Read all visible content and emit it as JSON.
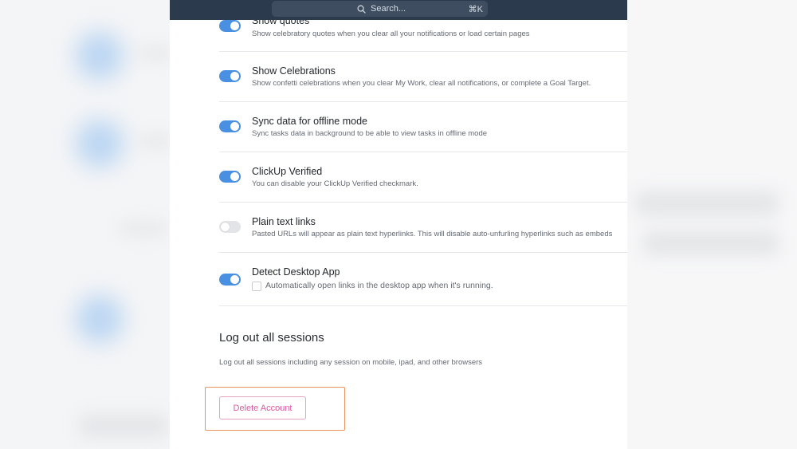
{
  "search": {
    "label": "Search...",
    "shortcut": "⌘K",
    "icon": "search-icon"
  },
  "settings": [
    {
      "title": "Show quotes",
      "description": "Show celebratory quotes when you clear all your notifications or load certain pages",
      "enabled": true
    },
    {
      "title": "Show Celebrations",
      "description": "Show confetti celebrations when you clear My Work, clear all notifications, or complete a Goal Target.",
      "enabled": true
    },
    {
      "title": "Sync data for offline mode",
      "description": "Sync tasks data in background to be able to view tasks in offline mode",
      "enabled": true
    },
    {
      "title": "ClickUp Verified",
      "description": "You can disable your ClickUp Verified checkmark.",
      "enabled": true
    },
    {
      "title": "Plain text links",
      "description": "Pasted URLs will appear as plain text hyperlinks. This will disable auto-unfurling hyperlinks such as embeds",
      "enabled": false
    },
    {
      "title": "Detect Desktop App",
      "checkbox_label": "Automatically open links in the desktop app when it's running.",
      "enabled": true,
      "checkbox_checked": false
    }
  ],
  "logout": {
    "title": "Log out all sessions",
    "description": "Log out all sessions including any session on mobile, ipad, and other browsers"
  },
  "delete_account": {
    "label": "Delete Account"
  },
  "colors": {
    "accent": "#4a90e2",
    "topbar": "#2b3a4d",
    "danger": "#d95aa0",
    "highlight": "#e8945a"
  }
}
